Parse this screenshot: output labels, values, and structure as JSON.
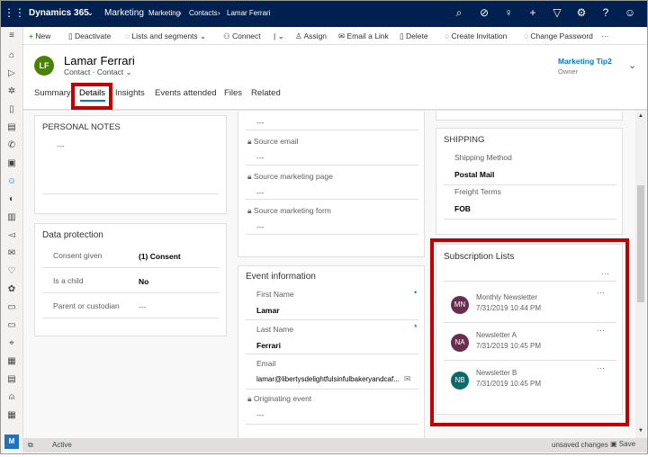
{
  "topbar": {
    "app": "Dynamics 365",
    "area": "Marketing",
    "breadcrumb": [
      "Marketing",
      "Contacts",
      "Lamar Ferrari"
    ],
    "icons": [
      "search-icon",
      "task-icon",
      "lightbulb-icon",
      "plus-icon",
      "filter-icon",
      "gear-icon",
      "help-icon",
      "user-icon"
    ]
  },
  "commands": [
    "New",
    "Deactivate",
    "Lists and segments",
    "Connect",
    "Assign",
    "Email a Link",
    "Delete",
    "Create Invitation",
    "Change Password"
  ],
  "record": {
    "initials": "LF",
    "name": "Lamar Ferrari",
    "type": "Contact",
    "form": "Contact",
    "owner": "Marketing Tip2",
    "owner_label": "Owner",
    "avatar_color": "#498205"
  },
  "tabs": [
    "Summary",
    "Details",
    "Insights",
    "Events attended",
    "Files",
    "Related"
  ],
  "active_tab": "Details",
  "personal_notes": {
    "title": "PERSONAL NOTES",
    "value": "---"
  },
  "data_protection": {
    "title": "Data protection",
    "rows": [
      {
        "label": "Consent given",
        "value": "(1) Consent"
      },
      {
        "label": "Is a child",
        "value": "No"
      },
      {
        "label": "Parent or custodian",
        "value": "---"
      }
    ]
  },
  "source": {
    "top_value": "---",
    "fields": [
      {
        "label": "Source email",
        "value": "---"
      },
      {
        "label": "Source marketing page",
        "value": "---"
      },
      {
        "label": "Source marketing form",
        "value": "---"
      }
    ]
  },
  "event_info": {
    "title": "Event information",
    "first_name_label": "First Name",
    "first_name": "Lamar",
    "last_name_label": "Last Name",
    "last_name": "Ferrari",
    "email_label": "Email",
    "email": "lamar@libertysdelightfulsinfulbakeryandcaf...",
    "originating_label": "Originating event",
    "originating": "---"
  },
  "shipping": {
    "title": "SHIPPING",
    "method_label": "Shipping Method",
    "method": "Postal Mail",
    "freight_label": "Freight Terms",
    "freight": "FOB"
  },
  "subscriptions": {
    "title": "Subscription Lists",
    "items": [
      {
        "initials": "MN",
        "name": "Monthly Newsletter",
        "date": "7/31/2019 10:44 PM",
        "color": "#6b2d4f"
      },
      {
        "initials": "NA",
        "name": "Newsletter A",
        "date": "7/31/2019 10:45 PM",
        "color": "#6b2d4f"
      },
      {
        "initials": "NB",
        "name": "Newsletter B",
        "date": "7/31/2019 10:45 PM",
        "color": "#0b6a6a"
      }
    ]
  },
  "status": {
    "state": "Active",
    "unsaved": "unsaved changes",
    "save": "Save",
    "app_initial": "M"
  },
  "colors": {
    "topbar": "#002050",
    "highlight": "#c00000",
    "accent": "#0078d4"
  }
}
